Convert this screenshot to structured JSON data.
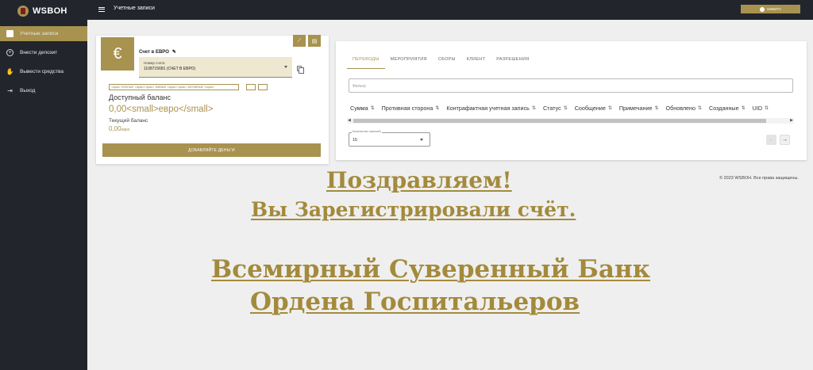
{
  "app": {
    "logo_text": "WSBOH"
  },
  "sidebar": {
    "items": [
      {
        "label": "Учетные записи",
        "icon": "id-card-icon",
        "active": true
      },
      {
        "label": "Внести депозит",
        "icon": "plus-circle-icon"
      },
      {
        "label": "Вывести средства",
        "icon": "hand-coin-icon"
      },
      {
        "label": "Выход",
        "icon": "logout-icon"
      }
    ]
  },
  "topbar": {
    "title": "Учетные записи",
    "user_label": "НИКИТА"
  },
  "account": {
    "currency_symbol": "€",
    "title": "Счет в ЕВРО",
    "select_label": "Номер счета",
    "select_value": "1108715681 (СЧЕТ В ЕВРО)",
    "tags": "<span> ЛИЧНЫЕ </span><span> ЖИВЫЕ </span><span> АКТИВНЫЕ </span>",
    "available_label": "Доступный баланс",
    "available_value": "0,00<small>евро</small>",
    "current_label": "Текущий баланс",
    "current_amount": "0,00",
    "current_unit": "евро",
    "add_money_label": "ДОБАВЛЯЙТЕ ДЕНЬГИ"
  },
  "transactions": {
    "tabs": [
      "ПЕРЕВОДЫ",
      "МЕРОПРИЯТИЯ",
      "СБОРЫ",
      "КЛИЕНТ",
      "РАЗРЕШЕНИЯ"
    ],
    "filter_placeholder": "Фильтр",
    "columns": [
      "Сумма",
      "Противная сторона",
      "Контрафактная учетная запись",
      "Статус",
      "Сообщение",
      "Примечание",
      "Обновлено",
      "Созданные",
      "UID"
    ],
    "page_size_label": "Количество записей",
    "page_size": "15"
  },
  "footer": {
    "text": "© 2023 WSBOH. Все права защищены."
  },
  "overlay": {
    "line1": "Поздравляем!",
    "line2": "Вы Зарегистрировали счёт.",
    "line3": "Всемирный Суверенный Банк",
    "line4": "Ордена Госпитальеров"
  },
  "colors": {
    "gold": "#a8924f",
    "sidebar": "#22252c",
    "headline": "#a38a3c"
  }
}
